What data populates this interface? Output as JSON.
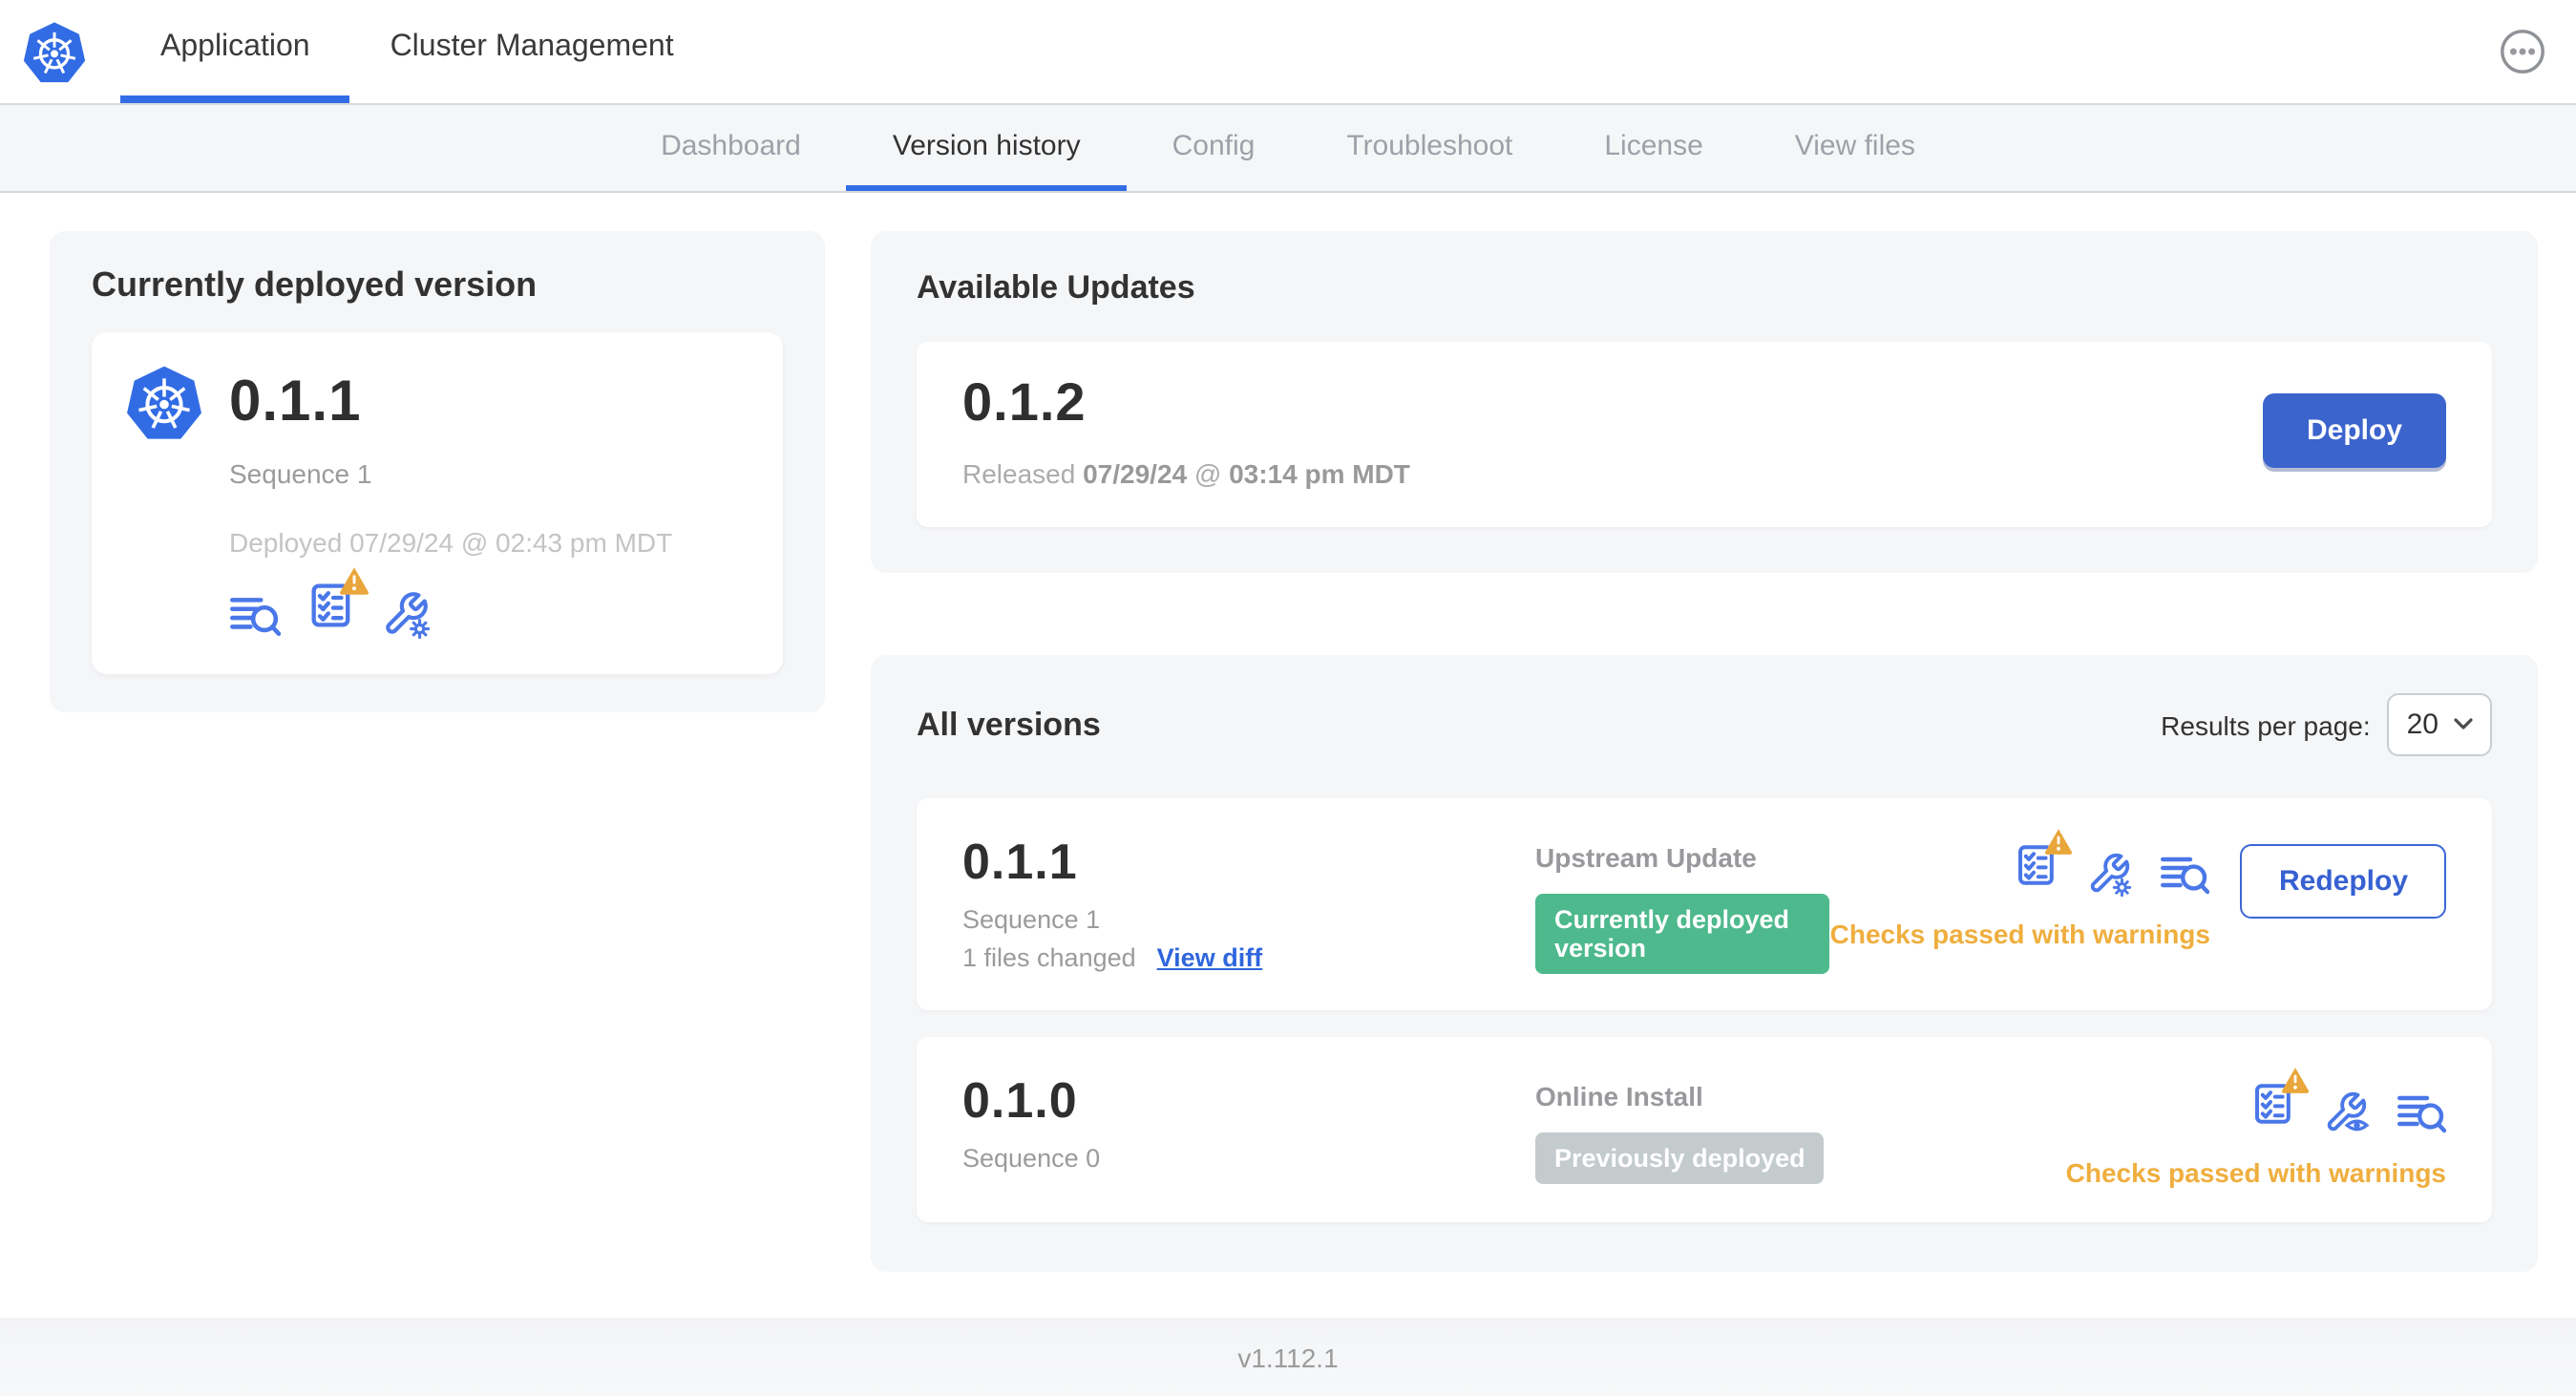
{
  "colors": {
    "accent_blue": "#326de6",
    "icon_blue": "#4a77e8",
    "deploy_button_blue": "#3c64cd",
    "link_blue": "#2f66dd",
    "warning_amber": "#efae3e",
    "badge_green": "#4db98c",
    "badge_gray": "#c4cbcd",
    "nav_bg": "#f5f6f8"
  },
  "header": {
    "logo_icon": "kubernetes-logo",
    "tabs": [
      {
        "label": "Application",
        "active": true
      },
      {
        "label": "Cluster Management",
        "active": false
      }
    ],
    "more_menu_icon": "ellipsis-icon"
  },
  "subnav": {
    "tabs": [
      {
        "label": "Dashboard",
        "active": false
      },
      {
        "label": "Version history",
        "active": true
      },
      {
        "label": "Config",
        "active": false
      },
      {
        "label": "Troubleshoot",
        "active": false
      },
      {
        "label": "License",
        "active": false
      },
      {
        "label": "View files",
        "active": false
      }
    ]
  },
  "current_version_card": {
    "title": "Currently deployed version",
    "version": "0.1.1",
    "sequence": "Sequence 1",
    "deployed_at": "Deployed 07/29/24 @ 02:43 pm MDT",
    "icons": [
      "release-notes-icon",
      "preflight-checks-warning-icon",
      "edit-config-icon"
    ]
  },
  "available_updates": {
    "title": "Available Updates",
    "version": "0.1.2",
    "released_prefix": "Released",
    "released_date": "07/29/24",
    "released_sep": "@",
    "released_time": "03:14 pm MDT",
    "deploy_button": "Deploy"
  },
  "all_versions": {
    "title": "All versions",
    "results_per_page_label": "Results per page:",
    "results_per_page_value": "20",
    "rows": [
      {
        "version": "0.1.1",
        "sequence": "Sequence 1",
        "files_changed": "1 files changed",
        "view_diff": "View diff",
        "source": "Upstream Update",
        "badge": "Currently deployed version",
        "badge_color": "#4db98c",
        "icons": [
          "preflight-checks-warning-icon",
          "edit-config-icon",
          "release-notes-icon"
        ],
        "status": "Checks passed with warnings",
        "action": "Redeploy"
      },
      {
        "version": "0.1.0",
        "sequence": "Sequence 0",
        "source": "Online Install",
        "badge": "Previously deployed",
        "badge_color": "#c4cbcd",
        "icons": [
          "preflight-checks-warning-icon",
          "view-config-icon",
          "release-notes-icon"
        ],
        "status": "Checks passed with warnings"
      }
    ]
  },
  "footer": {
    "version": "v1.112.1"
  }
}
